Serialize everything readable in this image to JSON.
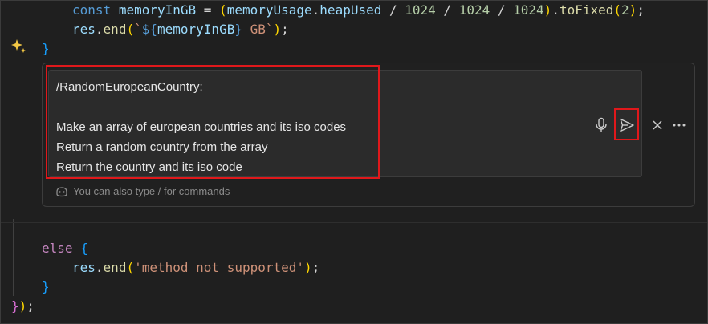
{
  "code_top": {
    "line1": {
      "const_kw": "const",
      "var_name": "memoryInGB",
      "eq": " = ",
      "paren_open": "(",
      "obj": "memoryUsage",
      "dot1": ".",
      "prop": "heapUsed",
      "div1": " / ",
      "n1": "1024",
      "div2": " / ",
      "n2": "1024",
      "div3": " / ",
      "n3": "1024",
      "paren_close": ")",
      "dot2": ".",
      "method": "toFixed",
      "p_open": "(",
      "n4": "2",
      "p_close": ")",
      "semi": ";"
    },
    "line2": {
      "obj": "res",
      "dot": ".",
      "method": "end",
      "p_open": "(",
      "tick_open": "`",
      "interp_open": "${",
      "interp_var": "memoryInGB",
      "interp_close": "}",
      "str_rest": " GB`",
      "p_close": ")",
      "semi": ";"
    },
    "line3": {
      "brace": "}"
    }
  },
  "inline_chat": {
    "prompt_lines": [
      "/RandomEuropeanCountry:",
      "",
      "Make an array of european countries and its iso codes",
      "Return a random country from the array",
      "Return the country and its iso code"
    ],
    "hint_text": "You can also type / for commands",
    "icons": {
      "mic": "microphone-icon",
      "send": "send-icon",
      "close": "close-icon",
      "more": "more-icon",
      "copilot": "copilot-icon",
      "sparkle": "sparkle-icon"
    }
  },
  "code_bottom": {
    "else_line": {
      "kw": "else",
      "brace": " {"
    },
    "res_line": {
      "obj": "res",
      "dot": ".",
      "method": "end",
      "p_open": "(",
      "str": "'method not supported'",
      "p_close": ")",
      "semi": ";"
    },
    "close_brace": "}",
    "final_line": {
      "brace": "}",
      "paren": ")",
      "semi": ";"
    }
  },
  "colors": {
    "highlight": "#e0181b",
    "background": "#1f1f1f"
  }
}
